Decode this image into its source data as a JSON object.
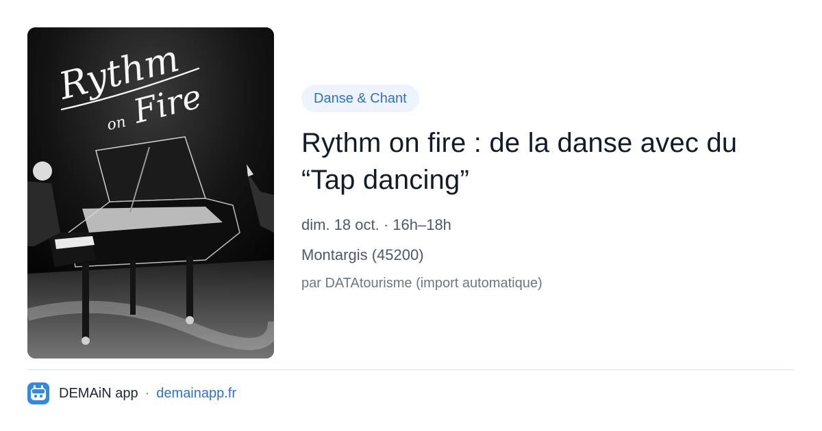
{
  "event": {
    "category": "Danse & Chant",
    "title": "Rythm on fire : de la danse avec du “Tap dancing”",
    "datetime": "dim. 18 oct. · 16h–18h",
    "location": "Montargis (45200)",
    "source": "par DATAtourisme (import automatique)",
    "image": {
      "kind": "black-and-white photo of a grand piano on stage",
      "logo_text": "Rythm on Fire"
    }
  },
  "footer": {
    "app_name": "DEMAiN app",
    "separator": "·",
    "link": "demainapp.fr",
    "logo_icon": "demain-app-icon"
  },
  "colors": {
    "accent": "#2f6fd0",
    "badge_bg": "#eef4fd",
    "title": "#131a2b",
    "muted": "#4e5868",
    "logo_bg": "#2d8ae8"
  }
}
